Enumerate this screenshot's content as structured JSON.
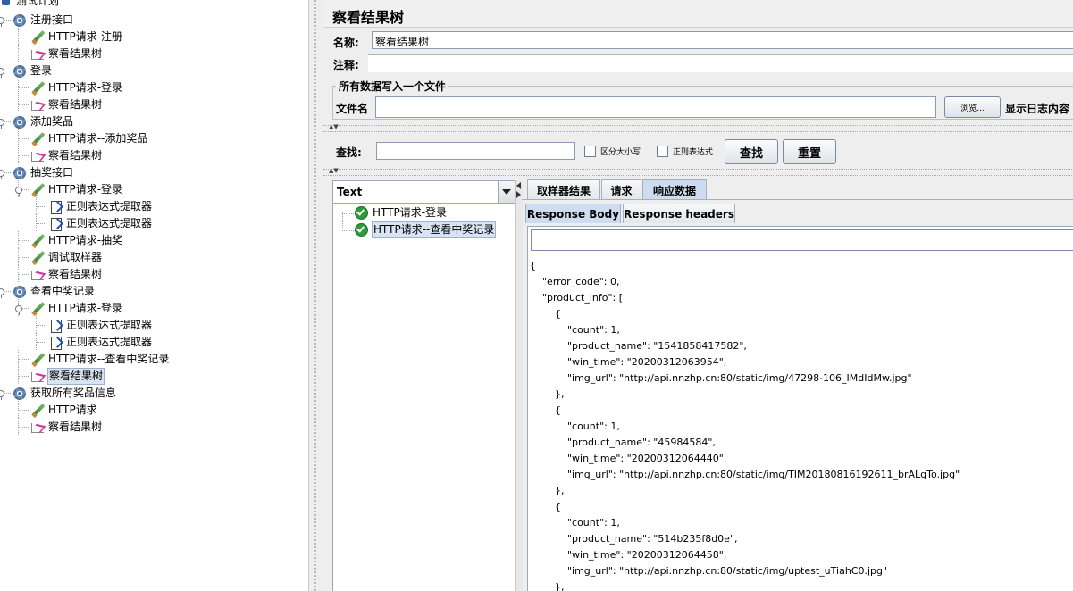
{
  "tree": {
    "root": "测试计划",
    "items": [
      {
        "label": "注册接口",
        "icon": "gear",
        "level": 1
      },
      {
        "label": "HTTP请求-注册",
        "icon": "pen",
        "level": 2
      },
      {
        "label": "察看结果树",
        "icon": "graph",
        "level": 2
      },
      {
        "label": "登录",
        "icon": "gear",
        "level": 1
      },
      {
        "label": "HTTP请求-登录",
        "icon": "pen",
        "level": 2
      },
      {
        "label": "察看结果树",
        "icon": "graph",
        "level": 2
      },
      {
        "label": "添加奖品",
        "icon": "gear",
        "level": 1
      },
      {
        "label": "HTTP请求--添加奖品",
        "icon": "pen",
        "level": 2
      },
      {
        "label": "察看结果树",
        "icon": "graph",
        "level": 2
      },
      {
        "label": "抽奖接口",
        "icon": "gear",
        "level": 1
      },
      {
        "label": "HTTP请求-登录",
        "icon": "pen",
        "level": 2
      },
      {
        "label": "正则表达式提取器",
        "icon": "doc",
        "level": 3
      },
      {
        "label": "正则表达式提取器",
        "icon": "doc",
        "level": 3
      },
      {
        "label": "HTTP请求-抽奖",
        "icon": "pen",
        "level": 2
      },
      {
        "label": "调试取样器",
        "icon": "pen",
        "level": 2
      },
      {
        "label": "察看结果树",
        "icon": "graph",
        "level": 2
      },
      {
        "label": "查看中奖记录",
        "icon": "gear",
        "level": 1
      },
      {
        "label": "HTTP请求-登录",
        "icon": "pen",
        "level": 2
      },
      {
        "label": "正则表达式提取器",
        "icon": "doc",
        "level": 3
      },
      {
        "label": "正则表达式提取器",
        "icon": "doc",
        "level": 3
      },
      {
        "label": "HTTP请求--查看中奖记录",
        "icon": "pen",
        "level": 2
      },
      {
        "label": "察看结果树",
        "icon": "graph",
        "level": 2,
        "selected": true
      },
      {
        "label": "获取所有奖品信息",
        "icon": "gear",
        "level": 1
      },
      {
        "label": "HTTP请求",
        "icon": "pen",
        "level": 2
      },
      {
        "label": "察看结果树",
        "icon": "graph",
        "level": 2
      }
    ]
  },
  "panel": {
    "title": "察看结果树",
    "name_label": "名称:",
    "name_value": "察看结果树",
    "comment_label": "注释:",
    "file_group": "所有数据写入一个文件",
    "file_label": "文件名",
    "browse_label": "浏览...",
    "log_label": "显示日志内容"
  },
  "search": {
    "label": "查找:",
    "case_label": "区分大小写",
    "regex_label": "正则表达式",
    "find_button": "查找",
    "reset_button": "重置"
  },
  "results": {
    "renderer": "Text",
    "samples": [
      {
        "label": "HTTP请求-登录",
        "status": "success"
      },
      {
        "label": "HTTP请求--查看中奖记录",
        "status": "success",
        "selected": true
      }
    ],
    "tabs": [
      "取样器结果",
      "请求",
      "响应数据"
    ],
    "active_tab": 2,
    "subtabs": [
      "Response Body",
      "Response headers"
    ],
    "active_subtab": 0,
    "body": "{\n\t\"error_code\": 0,\n\t\"product_info\": [\n\t\t{\n\t\t\t\"count\": 1,\n\t\t\t\"product_name\": \"1541858417582\",\n\t\t\t\"win_time\": \"20200312063954\",\n\t\t\t\"img_url\": \"http://api.nnzhp.cn:80/static/img/47298-106_IMdIdMw.jpg\"\n\t\t},\n\t\t{\n\t\t\t\"count\": 1,\n\t\t\t\"product_name\": \"45984584\",\n\t\t\t\"win_time\": \"20200312064440\",\n\t\t\t\"img_url\": \"http://api.nnzhp.cn:80/static/img/TIM20180816192611_brALgTo.jpg\"\n\t\t},\n\t\t{\n\t\t\t\"count\": 1,\n\t\t\t\"product_name\": \"514b235f8d0e\",\n\t\t\t\"win_time\": \"20200312064458\",\n\t\t\t\"img_url\": \"http://api.nnzhp.cn:80/static/img/uptest_uTiahC0.jpg\"\n\t\t},"
  }
}
